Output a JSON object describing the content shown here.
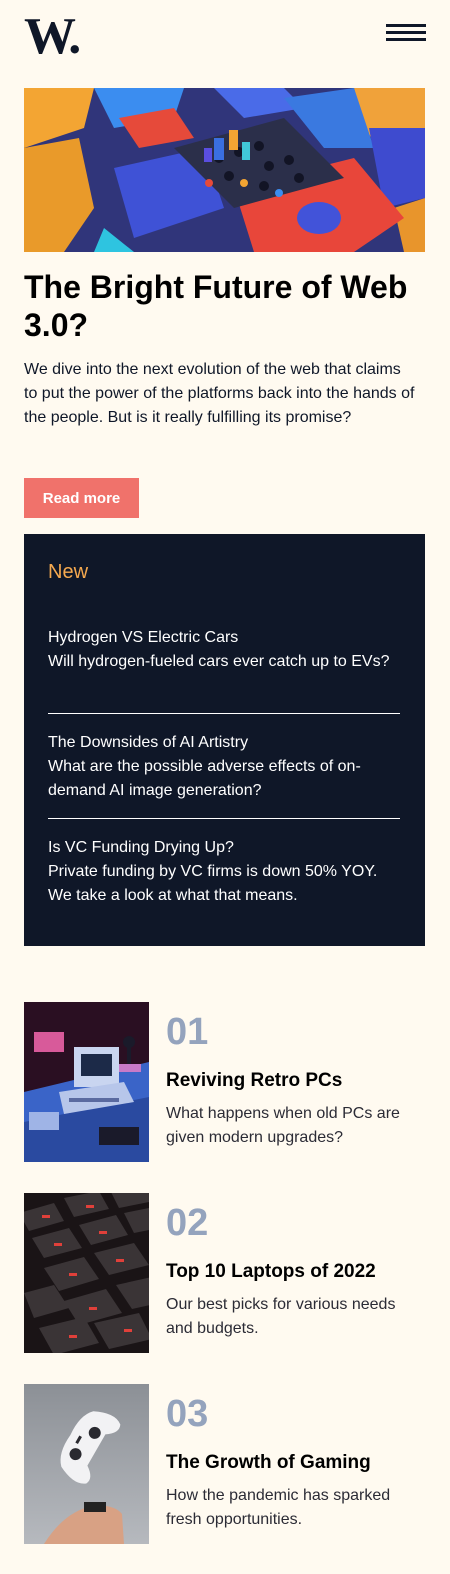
{
  "header": {
    "logo": "W.",
    "menu_icon": "hamburger-menu-icon"
  },
  "hero": {
    "title": "The Bright Future of Web 3.0?",
    "description": "We dive into the next evolution of the web that claims to put the power of the platforms back into the hands of the people. But is it really fulfilling its promise?",
    "cta_label": "Read more"
  },
  "new_panel": {
    "heading": "New",
    "items": [
      {
        "title": "Hydrogen VS Electric Cars",
        "description": "Will hydrogen-fueled cars ever catch up to EVs?"
      },
      {
        "title": "The Downsides of AI Artistry",
        "description": "What are the possible adverse effects of on-demand AI image generation?"
      },
      {
        "title": "Is VC Funding Drying Up?",
        "description": "Private funding by VC firms is down 50% YOY. We take a look at what that means."
      }
    ]
  },
  "articles": [
    {
      "number": "01",
      "title": "Reviving Retro PCs",
      "description": "What happens when old PCs are given modern upgrades?"
    },
    {
      "number": "02",
      "title": "Top 10 Laptops of 2022",
      "description": "Our best picks for various needs and budgets."
    },
    {
      "number": "03",
      "title": "The Growth of Gaming",
      "description": "How the pandemic has sparked fresh opportunities."
    }
  ],
  "colors": {
    "background": "#fffaf0",
    "dark": "#0f1728",
    "accent_red": "#f0726b",
    "accent_orange": "#f5a94f",
    "muted_number": "#94a3bd"
  }
}
